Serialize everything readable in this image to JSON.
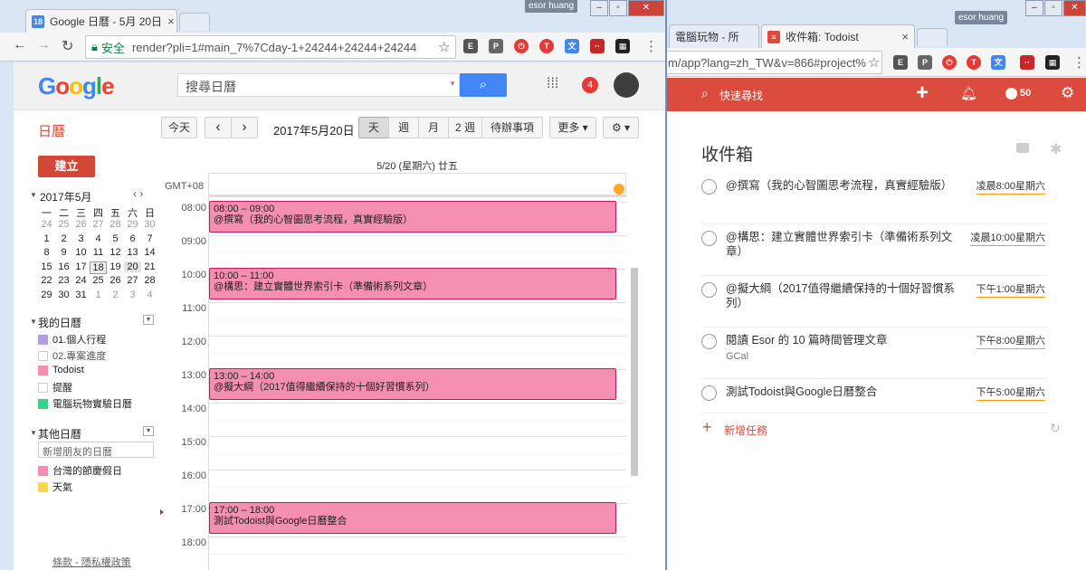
{
  "left_window": {
    "tab_title": "Google 日曆 - 5月 20日",
    "tab_favicon": "18",
    "user_badge": "esor huang",
    "address_secure": "安全",
    "address_url": "render?pli=1#main_7%7Cday-1+24244+24244+24244",
    "notification_count": "4",
    "search_placeholder": "搜尋日曆",
    "app_name": "日曆",
    "toolbar": {
      "today": "今天",
      "prev": "‹",
      "next": "›",
      "date": "2017年5月20日",
      "view_day": "天",
      "view_week": "週",
      "view_month": "月",
      "view_2week": "2 週",
      "view_agenda": "待辦事項",
      "more": "更多 ▾",
      "settings": "⚙ ▾"
    },
    "create_button": "建立",
    "mini_cal": {
      "title": "2017年5月",
      "nav": "‹  ›",
      "weekdays": [
        "一",
        "二",
        "三",
        "四",
        "五",
        "六",
        "日"
      ],
      "weeks": [
        [
          "24",
          "25",
          "26",
          "27",
          "28",
          "29",
          "30"
        ],
        [
          "1",
          "2",
          "3",
          "4",
          "5",
          "6",
          "7"
        ],
        [
          "8",
          "9",
          "10",
          "11",
          "12",
          "13",
          "14"
        ],
        [
          "15",
          "16",
          "17",
          "18",
          "19",
          "20",
          "21"
        ],
        [
          "22",
          "23",
          "24",
          "25",
          "26",
          "27",
          "28"
        ],
        [
          "29",
          "30",
          "31",
          "1",
          "2",
          "3",
          "4"
        ]
      ]
    },
    "my_calendars": {
      "title": "我的日曆",
      "items": [
        {
          "label": "01.個人行程",
          "color": "#b39ddb"
        },
        {
          "label": "02.專案進度",
          "color": "#ffffff"
        },
        {
          "label": "Todoist",
          "color": "#f48fb1"
        },
        {
          "label": "提醒",
          "color": "#ffffff"
        },
        {
          "label": "電腦玩物實驗日曆",
          "color": "#3dcf8e"
        }
      ]
    },
    "other_calendars": {
      "title": "其他日曆",
      "add_placeholder": "新增朋友的日曆",
      "items": [
        {
          "label": "台灣的節慶假日",
          "color": "#f48fb1"
        },
        {
          "label": "天氣",
          "color": "#ffd54f"
        }
      ]
    },
    "footer": "條款 - 隱私權政策",
    "day_header": "5/20 (星期六) 廿五",
    "timezone": "GMT+08",
    "hours": [
      "08:00",
      "09:00",
      "10:00",
      "11:00",
      "12:00",
      "13:00",
      "14:00",
      "15:00",
      "16:00",
      "17:00",
      "18:00"
    ],
    "events": [
      {
        "time": "08:00 – 09:00",
        "title": "@撰寫（我的心智圖思考流程，真實經驗版）"
      },
      {
        "time": "10:00 – 11:00",
        "title": "@構思：建立實體世界索引卡（準備術系列文章）"
      },
      {
        "time": "13:00 – 14:00",
        "title": "@擬大綱（2017值得繼續保持的十個好習慣系列）"
      },
      {
        "time": "17:00 – 18:00",
        "title": "測試Todoist與Google日曆整合"
      }
    ]
  },
  "right_window": {
    "tab_inactive": "電腦玩物 - 所",
    "tab_title": "收件箱: Todoist",
    "user_badge": "esor huang",
    "address_url": "m/app?lang=zh_TW&v=866#project%",
    "quick_find": "快速尋找",
    "karma": "50",
    "inbox_title": "收件箱",
    "tasks": [
      {
        "text": "@撰寫（我的心智圖思考流程，真實經驗版）",
        "sub": "",
        "date": "凌晨8:00星期六"
      },
      {
        "text": "@構思：建立實體世界索引卡（準備術系列文章）",
        "sub": "",
        "date": "凌晨10:00星期六"
      },
      {
        "text": "@擬大綱（2017值得繼續保持的十個好習慣系列）",
        "sub": "",
        "date": "下午1:00星期六"
      },
      {
        "text": "閱讀 Esor 的 10 篇時間管理文章",
        "sub": "GCal",
        "date": "下午8:00星期六"
      },
      {
        "text": "測試Todoist與Google日曆整合",
        "sub": "",
        "date": "下午5:00星期六"
      }
    ],
    "add_task": "新增任務"
  },
  "colors": {
    "gcal_red": "#dd4b39",
    "todoist_red": "#db4c3f",
    "event_pink": "#f48fb1",
    "google_blue": "#4285f4"
  }
}
